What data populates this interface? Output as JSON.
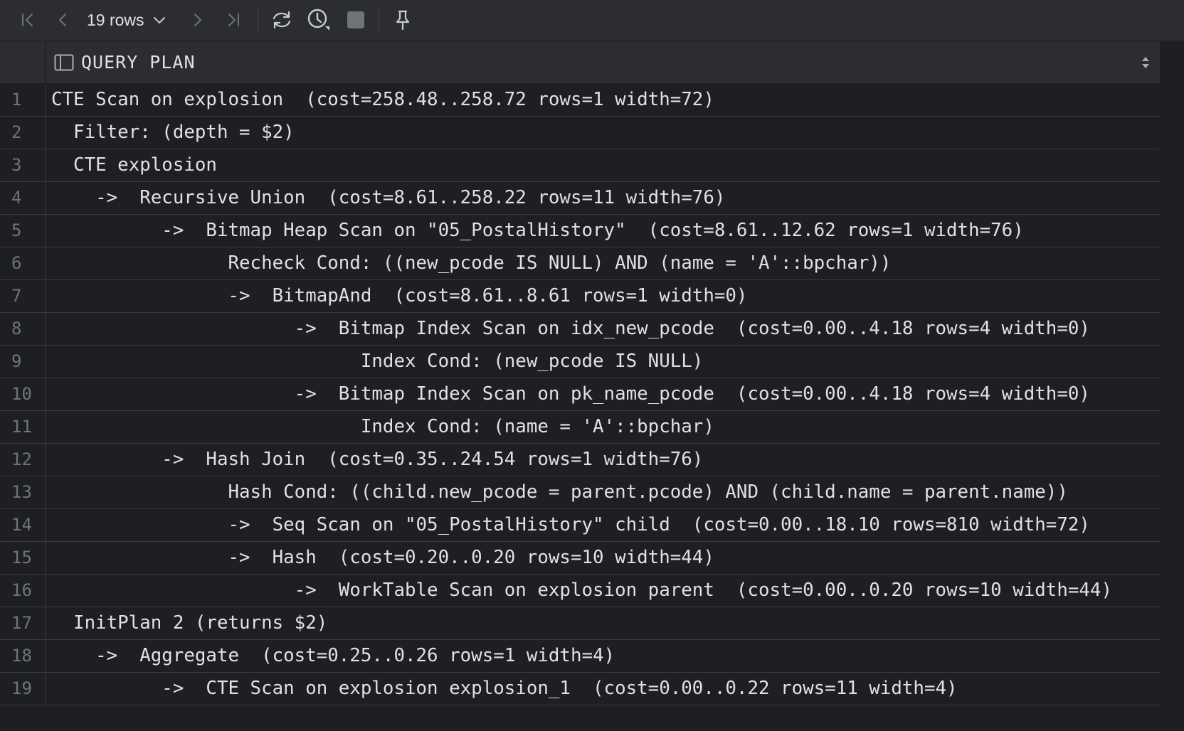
{
  "toolbar": {
    "rows_label": "19 rows",
    "icons": [
      "first-page-icon",
      "prev-page-icon",
      "next-page-icon",
      "last-page-icon",
      "reload-icon",
      "history-icon",
      "stop-icon",
      "pin-icon"
    ]
  },
  "grid": {
    "column_header": "QUERY PLAN",
    "rows": [
      {
        "n": "1",
        "text": "CTE Scan on explosion  (cost=258.48..258.72 rows=1 width=72)"
      },
      {
        "n": "2",
        "text": "  Filter: (depth = $2)"
      },
      {
        "n": "3",
        "text": "  CTE explosion"
      },
      {
        "n": "4",
        "text": "    ->  Recursive Union  (cost=8.61..258.22 rows=11 width=76)"
      },
      {
        "n": "5",
        "text": "          ->  Bitmap Heap Scan on \"05_PostalHistory\"  (cost=8.61..12.62 rows=1 width=76)"
      },
      {
        "n": "6",
        "text": "                Recheck Cond: ((new_pcode IS NULL) AND (name = 'A'::bpchar))"
      },
      {
        "n": "7",
        "text": "                ->  BitmapAnd  (cost=8.61..8.61 rows=1 width=0)"
      },
      {
        "n": "8",
        "text": "                      ->  Bitmap Index Scan on idx_new_pcode  (cost=0.00..4.18 rows=4 width=0)"
      },
      {
        "n": "9",
        "text": "                            Index Cond: (new_pcode IS NULL)"
      },
      {
        "n": "10",
        "text": "                      ->  Bitmap Index Scan on pk_name_pcode  (cost=0.00..4.18 rows=4 width=0)"
      },
      {
        "n": "11",
        "text": "                            Index Cond: (name = 'A'::bpchar)"
      },
      {
        "n": "12",
        "text": "          ->  Hash Join  (cost=0.35..24.54 rows=1 width=76)"
      },
      {
        "n": "13",
        "text": "                Hash Cond: ((child.new_pcode = parent.pcode) AND (child.name = parent.name))"
      },
      {
        "n": "14",
        "text": "                ->  Seq Scan on \"05_PostalHistory\" child  (cost=0.00..18.10 rows=810 width=72)"
      },
      {
        "n": "15",
        "text": "                ->  Hash  (cost=0.20..0.20 rows=10 width=44)"
      },
      {
        "n": "16",
        "text": "                      ->  WorkTable Scan on explosion parent  (cost=0.00..0.20 rows=10 width=44)"
      },
      {
        "n": "17",
        "text": "  InitPlan 2 (returns $2)"
      },
      {
        "n": "18",
        "text": "    ->  Aggregate  (cost=0.25..0.26 rows=1 width=4)"
      },
      {
        "n": "19",
        "text": "          ->  CTE Scan on explosion explosion_1  (cost=0.00..0.22 rows=11 width=4)"
      }
    ]
  }
}
